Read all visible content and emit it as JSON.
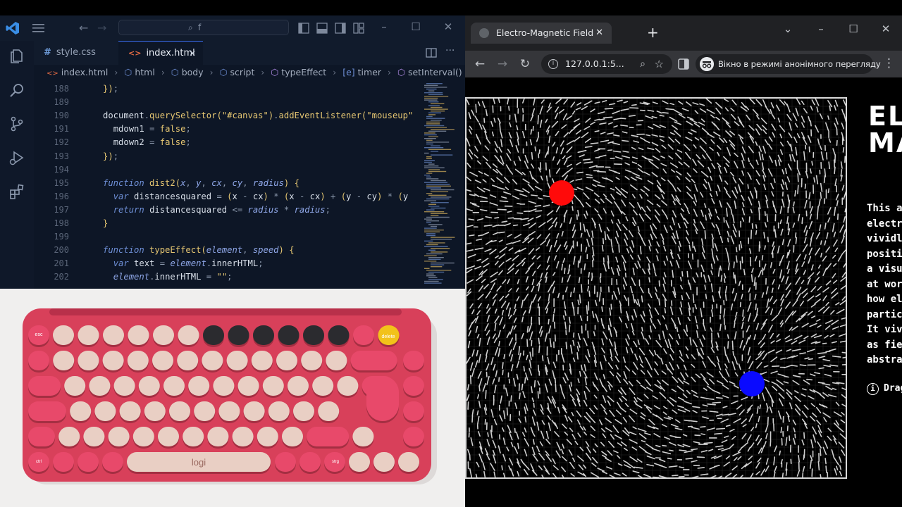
{
  "vscode": {
    "search_text": "f",
    "tabs": [
      {
        "icon": "#",
        "label": "style.css",
        "active": false
      },
      {
        "icon": "<>",
        "label": "index.html",
        "active": true
      }
    ],
    "tab_close": "✕",
    "breadcrumb": [
      "index.html",
      "html",
      "body",
      "script",
      "typeEffect",
      "timer",
      "setInterval() callback"
    ],
    "line_numbers": [
      "188",
      "189",
      "190",
      "191",
      "192",
      "193",
      "194",
      "195",
      "196",
      "197",
      "198",
      "199",
      "200",
      "201",
      "202"
    ],
    "code_lines": [
      "});",
      "",
      "document.querySelector(\"#canvas\").addEventListener(\"mouseup\"",
      "  mdown1 = false;",
      "  mdown2 = false;",
      "});",
      "",
      "function dist2(x, y, cx, cy, radius) {",
      "  var distancesquared = (x - cx) * (x - cx) + (y - cy) * (y",
      "  return distancesquared <= radius * radius;",
      "}",
      "",
      "function typeEffect(element, speed) {",
      "  var text = element.innerHTML;",
      "  element.innerHTML = \"\";"
    ]
  },
  "photo": {
    "brand_label": "logi",
    "key_labels": [
      "esc",
      "delete",
      "strg",
      "ctrl"
    ],
    "colors": {
      "body": "#d8405a",
      "keycap": "#e9cfc4",
      "dark_key": "#2b2b2f",
      "accent_key": "#e8496a",
      "emoji_key": "#f2c21a"
    }
  },
  "browser": {
    "tab_title": "Electro-Magnetic Field",
    "tab_close": "✕",
    "new_tab": "+",
    "url": "127.0.0.1:5...",
    "incognito_label": "Вікно в режимі анонімного перегляду",
    "page": {
      "title": "EL\nMA",
      "paragraph": "This a\nelectr\nvividl\npositi\na visu\nat wor\nhow el\npartic\nIt viv\nas fie\nabstra",
      "hint": "Drag",
      "hint_icon": "i"
    },
    "field": {
      "charge_positive_color": "#ff0a0a",
      "charge_negative_color": "#0a0aff",
      "line_color": "#e6e6e6",
      "grid_color": "#262626"
    }
  }
}
